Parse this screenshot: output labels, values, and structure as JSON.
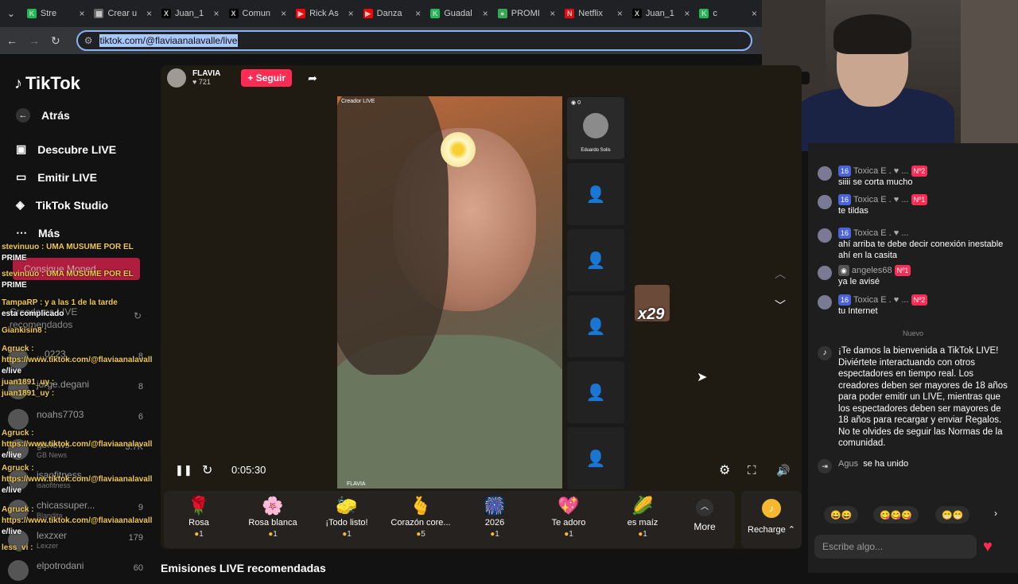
{
  "browser": {
    "tabs": [
      {
        "label": "Stre",
        "color": "#1db954",
        "glyph": "K"
      },
      {
        "label": "Crear u",
        "color": "#666",
        "glyph": "▦"
      },
      {
        "label": "Juan_1",
        "color": "#000",
        "glyph": "X"
      },
      {
        "label": "Comun",
        "color": "#000",
        "glyph": "X"
      },
      {
        "label": "Rick As",
        "color": "#ff0000",
        "glyph": "▶"
      },
      {
        "label": "Danza",
        "color": "#ff0000",
        "glyph": "▶"
      },
      {
        "label": "Guadal",
        "color": "#1db954",
        "glyph": "K"
      },
      {
        "label": "PROMI",
        "color": "#34a853",
        "glyph": "●"
      },
      {
        "label": "Netflix",
        "color": "#e50914",
        "glyph": "N"
      },
      {
        "label": "Juan_1",
        "color": "#000",
        "glyph": "X"
      },
      {
        "label": "c",
        "color": "#1db954",
        "glyph": "K"
      }
    ],
    "url": "tiktok.com/@flaviaanalavalle/live"
  },
  "sidebar": {
    "logo": "TikTok",
    "back": "Atrás",
    "items": [
      "Descubre LIVE",
      "Emitir LIVE",
      "TikTok Studio",
      "Más"
    ],
    "coins_button": "Consigue Moned",
    "section": "Creadores LIVE recomendados",
    "creators": [
      {
        "name": "...0223_",
        "count": "8"
      },
      {
        "name": "jorge.degani",
        "count": "8"
      },
      {
        "name": "noahs7703",
        "count": "6"
      },
      {
        "name": "gbnews",
        "sub": "GB News",
        "count": "3.7K"
      },
      {
        "name": "isaofitness",
        "sub": "isaofitness",
        "count": ""
      },
      {
        "name": "chicassuper...",
        "sub": "Blandita",
        "count": "9"
      },
      {
        "name": "lexzxer",
        "sub": "Lexzer",
        "count": "179"
      },
      {
        "name": "elpotrodani",
        "count": "60"
      }
    ],
    "overlay_chat": [
      "stevinuuo : UMA MUSUME POR EL",
      "PRIME",
      "stevinuuo : UMA MUSUME POR EL",
      "PRIME",
      "TampaRP : y a las 1 de la tarde",
      "esta complicado",
      "Giankisin8 :",
      "Agruck :",
      "https://www.tiktok.com/@flaviaanalavall",
      "e/live",
      "juan1891_uy :",
      "juan1891_uy :",
      "Agruck :",
      "https://www.tiktok.com/@flaviaanalavall",
      "e/live",
      "Agruck :",
      "https://www.tiktok.com/@flaviaanalavall",
      "e/live",
      "Agruck :",
      "https://www.tiktok.com/@flaviaanalavall",
      "e/live",
      "less_vi :"
    ]
  },
  "stream": {
    "host_name": "FLAVIA",
    "likes": "721",
    "follow_label": "+ Seguir",
    "creator_tag": "Creador LIVE",
    "guest_name": "Eduardo Solis",
    "guest_count": "0",
    "multiplier": "x29",
    "timer": "0:05:30",
    "recommended_title": "Emisiones LIVE recomendadas"
  },
  "gifts": [
    {
      "name": "Rosa",
      "price": "1",
      "icon": "🌹"
    },
    {
      "name": "Rosa blanca",
      "price": "1",
      "icon": "🌸"
    },
    {
      "name": "¡Todo listo!",
      "price": "1",
      "icon": "🧽"
    },
    {
      "name": "Corazón core...",
      "price": "5",
      "icon": "🫰"
    },
    {
      "name": "2026",
      "price": "1",
      "icon": "🎆"
    },
    {
      "name": "Te adoro",
      "price": "1",
      "icon": "💖"
    },
    {
      "name": "es maíz",
      "price": "1",
      "icon": "🌽"
    }
  ],
  "gifts_more": "More",
  "recharge": "Recharge",
  "chat": {
    "messages": [
      {
        "user": "Toxica E . ♥ ...",
        "level": "16",
        "rank": "Nº2",
        "text": "siiii se corta mucho"
      },
      {
        "user": "Toxica E . ♥ ...",
        "level": "16",
        "rank": "Nº1",
        "text": "te tildas"
      },
      {
        "user": "Toxica E . ♥ ...",
        "level": "16",
        "rank": "",
        "text": "ahí arriba te debe decir conexión inestable ahí en la casita"
      },
      {
        "user": "angeles68",
        "level": "",
        "rank": "Nº1",
        "text": "ya le avisé"
      },
      {
        "user": "Toxica E . ♥ ...",
        "level": "16",
        "rank": "Nº2",
        "text": "tu Internet"
      }
    ],
    "new_label": "Nuevo",
    "welcome": "¡Te damos la bienvenida a TikTok LIVE! Diviértete interactuando con otros espectadores en tiempo real. Los creadores deben ser mayores de 18 años para poder emitir un LIVE, mientras que los espectadores deben ser mayores de 18 años para recargar y enviar Regalos. No te olvides de seguir las Normas de la comunidad.",
    "joined_user": "Agus",
    "joined_text": "se ha unido",
    "quick_emojis": [
      "😄😄",
      "😋😋😋",
      "😁😁"
    ],
    "input_placeholder": "Escribe algo..."
  }
}
